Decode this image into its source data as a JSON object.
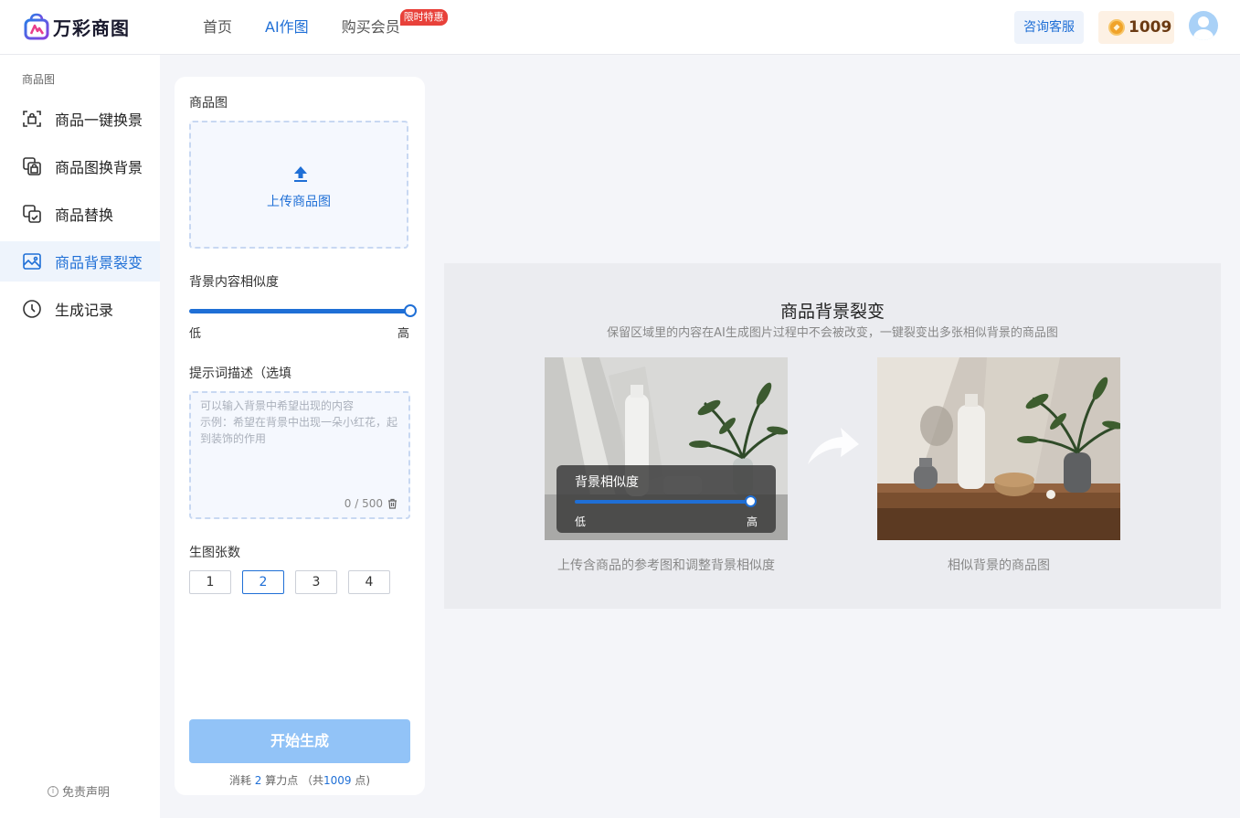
{
  "header": {
    "logo_text": "万彩商图",
    "nav": [
      {
        "label": "首页"
      },
      {
        "label": "AI作图"
      },
      {
        "label": "购买会员",
        "badge": "限时特惠"
      }
    ],
    "service_label": "咨询客服",
    "points": "1009"
  },
  "sidebar": {
    "section_title": "商品图",
    "items": [
      {
        "label": "商品一键换景",
        "icon": "scene-swap-icon"
      },
      {
        "label": "商品图换背景",
        "icon": "background-swap-icon"
      },
      {
        "label": "商品替换",
        "icon": "product-replace-icon"
      },
      {
        "label": "商品背景裂变",
        "icon": "background-fission-icon"
      },
      {
        "label": "生成记录",
        "icon": "clock-icon"
      }
    ],
    "active_index": 3,
    "disclaimer": "免责声明"
  },
  "form": {
    "product_label": "商品图",
    "upload_label": "上传商品图",
    "similarity_label": "背景内容相似度",
    "similarity_value": 1.0,
    "low_label": "低",
    "high_label": "高",
    "prompt_label": "提示词描述（选填",
    "prompt_placeholder": "可以输入背景中希望出现的内容\n示例：希望在背景中出现一朵小红花，起到装饰的作用",
    "prompt_count": "0 / 500",
    "count_label": "生图张数",
    "count_options": [
      "1",
      "2",
      "3",
      "4"
    ],
    "count_selected": "2",
    "generate_label": "开始生成",
    "consume_prefix": "消耗 ",
    "consume_cost": "2",
    "consume_mid": " 算力点 （共",
    "consume_total": "1009",
    "consume_suffix": " 点)"
  },
  "demo": {
    "title": "商品背景裂变",
    "subtitle": "保留区域里的内容在AI生成图片过程中不会被改变，一键裂变出多张相似背景的商品图",
    "overlay_title": "背景相似度",
    "overlay_low": "低",
    "overlay_high": "高",
    "overlay_value": 1.0,
    "caption_left": "上传含商品的参考图和调整背景相似度",
    "caption_right": "相似背景的商品图"
  },
  "colors": {
    "accent": "#1f6fd6",
    "promo": "#e8413a",
    "generate_disabled": "#92c3f7"
  }
}
